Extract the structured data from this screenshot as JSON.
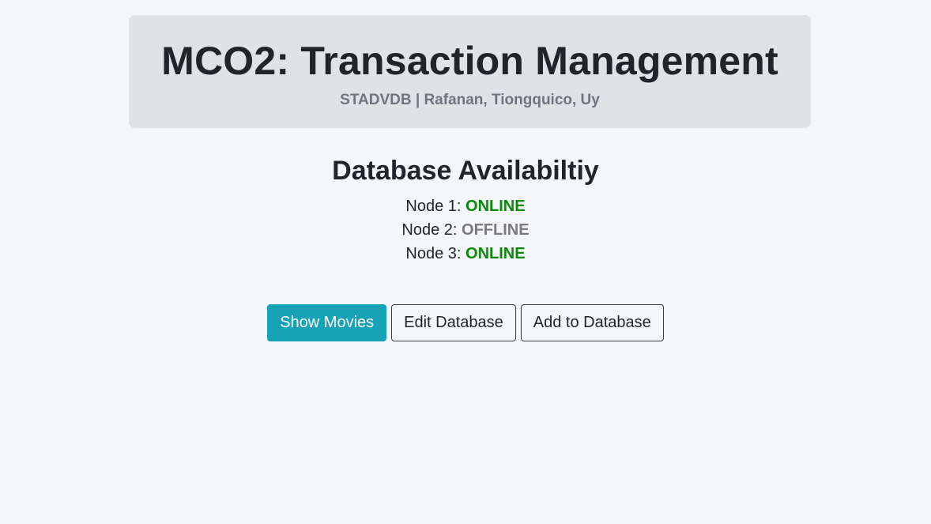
{
  "header": {
    "title": "MCO2: Transaction Management",
    "subtitle": "STADVDB | Rafanan, Tiongquico, Uy"
  },
  "availability": {
    "heading": "Database Availabiltiy",
    "nodes": [
      {
        "label": "Node 1:",
        "status": "ONLINE",
        "status_color": "#0a8a0a"
      },
      {
        "label": "Node 2:",
        "status": "OFFLINE",
        "status_color": "#7a7a7a"
      },
      {
        "label": "Node 3:",
        "status": "ONLINE",
        "status_color": "#0a8a0a"
      }
    ]
  },
  "actions": {
    "show_movies": "Show Movies",
    "edit_database": "Edit Database",
    "add_to_database": "Add to Database"
  },
  "colors": {
    "accent": "#17a2b8",
    "online": "#0a8a0a",
    "offline": "#7a7a7a"
  }
}
